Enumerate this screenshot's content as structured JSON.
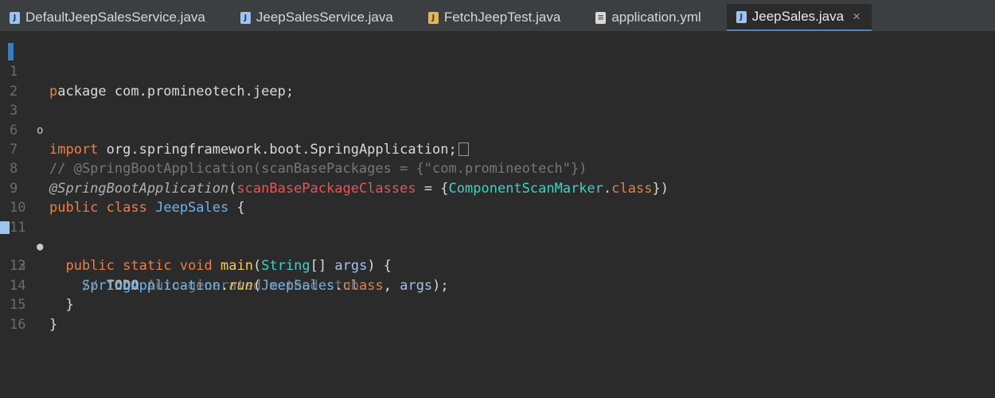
{
  "tabs": [
    {
      "label": "DefaultJeepSalesService.java",
      "icon": "java-file-icon",
      "active": false
    },
    {
      "label": "JeepSalesService.java",
      "icon": "java-file-icon",
      "active": false
    },
    {
      "label": "FetchJeepTest.java",
      "icon": "java-test-file-icon",
      "active": false
    },
    {
      "label": "application.yml",
      "icon": "yml-file-icon",
      "active": false
    },
    {
      "label": "JeepSales.java",
      "icon": "java-file-icon",
      "active": true,
      "close": "×"
    }
  ],
  "editor": {
    "line_numbers": [
      "1",
      "2",
      "3",
      "6",
      "7",
      "8",
      "9",
      "10",
      "11",
      "12",
      "13",
      "14",
      "15",
      "16"
    ],
    "fold_markers": {
      "3": "o",
      "11": "●"
    },
    "lines": {
      "l1": {
        "p": "p",
        "rest": "ackage com.promineotech.jeep;"
      },
      "l3": {
        "kw": "import",
        "rest": " org.springframework.boot.SpringApplication;"
      },
      "l7": {
        "comment": "// @SpringBootApplication(scanBasePackages = {\"com.promineotech\"})"
      },
      "l8": {
        "ann": "@SpringBootApplication",
        "p1": "(",
        "field": "scanBasePackageClasses",
        "p2": " = {",
        "type": "ComponentScanMarker",
        "p3": ".",
        "kw": "class",
        "p4": "})"
      },
      "l9": {
        "kw1": "public",
        "kw2": "class",
        "name": "JeepSales",
        "brace": " {"
      },
      "l11": {
        "kw1": "public",
        "kw2": "static",
        "kw3": "void",
        "method": "main",
        "p1": "(",
        "type": "String",
        "p2": "[] ",
        "arg": "args",
        "p3": ") {"
      },
      "l12": {
        "c1": "// ",
        "todo": "TODO",
        "c2": " Auto-generated method stub"
      },
      "l13": {
        "cls": "SpringApplication",
        "dot": ".",
        "method": "run",
        "p1": "(",
        "cls2": "JeepSales",
        "dot2": ".",
        "kw": "class",
        "p2": ", ",
        "arg": "args",
        "p3": ");"
      },
      "l14": {
        "brace": "}"
      },
      "l15": {
        "brace": "}"
      }
    }
  }
}
